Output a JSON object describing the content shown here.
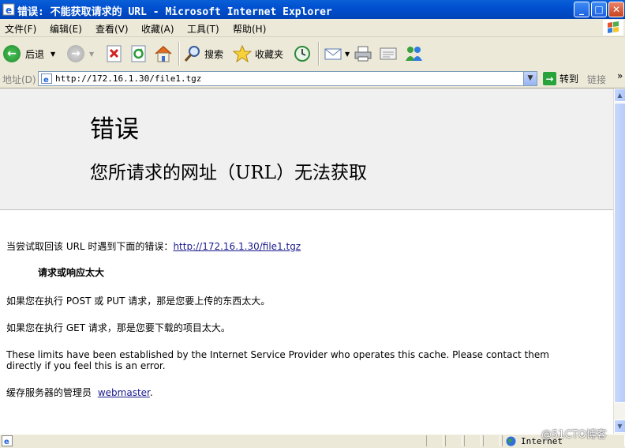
{
  "window": {
    "title": "错误: 不能获取请求的 URL - Microsoft Internet Explorer",
    "minimize_label": "_",
    "maximize_label": "□",
    "close_label": "✕"
  },
  "menu": {
    "items": [
      "文件(F)",
      "编辑(E)",
      "查看(V)",
      "收藏(A)",
      "工具(T)",
      "帮助(H)"
    ]
  },
  "toolbar": {
    "back_label": "后退",
    "search_label": "搜索",
    "favorites_label": "收藏夹"
  },
  "address": {
    "label": "地址(D)",
    "url": "http://172.16.1.30/file1.tgz",
    "go_label": "转到",
    "links_label": "链接",
    "more": "»"
  },
  "page": {
    "heading": "错误",
    "subheading": "您所请求的网址（URL）无法获取",
    "attempt_prefix": "当尝试取回该 URL 时遇到下面的错误：",
    "attempt_link": "http://172.16.1.30/file1.tgz",
    "reason": "请求或响应太大",
    "post_put_msg": "如果您在执行 POST 或 PUT 请求，那是您要上传的东西太大。",
    "get_msg": "如果您在执行 GET 请求，那是您要下载的项目太大。",
    "limits_line1": "These limits have been established by the Internet Service Provider who operates this cache. Please contact them",
    "limits_line2": "directly if you feel this is an error.",
    "admin_prefix": "缓存服务器的管理员",
    "admin_link": "webmaster",
    "admin_suffix": "."
  },
  "status": {
    "zone": "Internet",
    "watermark": "@51CTO博客"
  },
  "colors": {
    "titlebar": "#0050d0",
    "link": "#1b1b8f",
    "header_band": "#f0f0f0"
  }
}
